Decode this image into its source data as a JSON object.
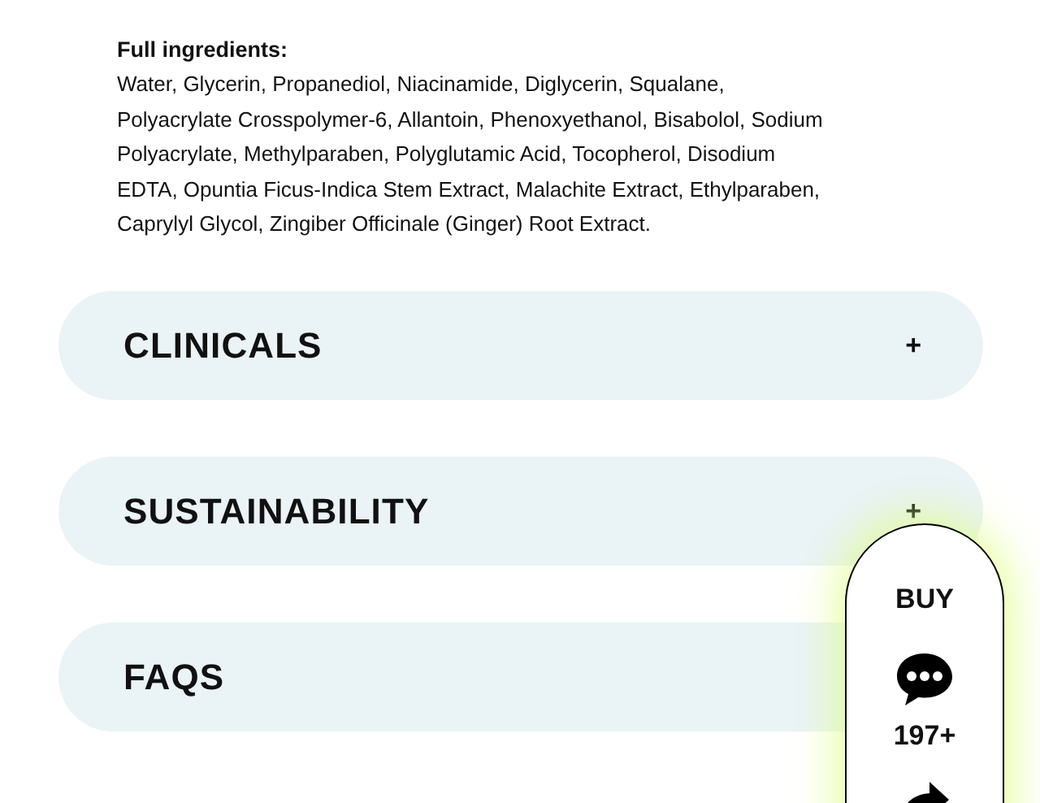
{
  "ingredients": {
    "heading": "Full ingredients:",
    "text": "Water, Glycerin, Propanediol, Niacinamide, Diglycerin, Squalane,\nPolyacrylate Crosspolymer-6, Allantoin, Phenoxyethanol, Bisabolol, Sodium\nPolyacrylate, Methylparaben, Polyglutamic Acid, Tocopherol, Disodium\nEDTA, Opuntia Ficus-Indica Stem Extract, Malachite Extract, Ethylparaben,\nCaprylyl Glycol, Zingiber Officinale (Ginger) Root Extract."
  },
  "sections": [
    {
      "title": "CLINICALS",
      "toggle": "+"
    },
    {
      "title": "SUSTAINABILITY",
      "toggle": "+"
    },
    {
      "title": "FAQS"
    }
  ],
  "floating_widget": {
    "buy": "BUY",
    "count": "197+"
  }
}
